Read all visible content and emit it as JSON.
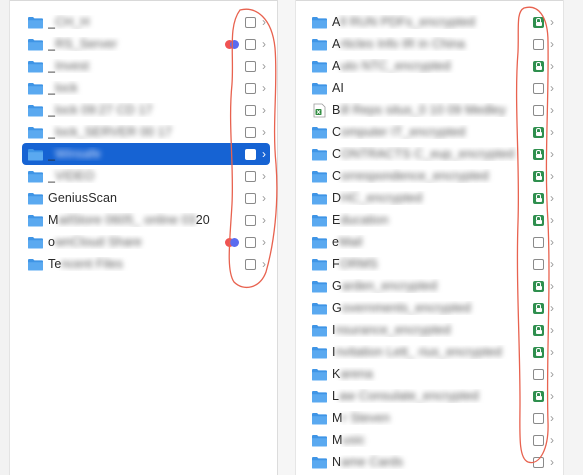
{
  "left_column": {
    "items": [
      {
        "lead": "_",
        "blurred": "CH_H",
        "tail": "",
        "status": "check",
        "tags": []
      },
      {
        "lead": "_",
        "blurred": "RS_Server",
        "tail": "",
        "status": "check",
        "tags": [
          "red",
          "blue"
        ]
      },
      {
        "lead": "_",
        "blurred": "Invest",
        "tail": "",
        "status": "check",
        "tags": []
      },
      {
        "lead": "_",
        "blurred": "lock",
        "tail": "",
        "status": "check",
        "tags": []
      },
      {
        "lead": "_",
        "blurred": "lock 09:27 CD 17",
        "tail": "",
        "status": "check",
        "tags": []
      },
      {
        "lead": "_",
        "blurred": "lock_SERVER 00 17",
        "tail": "",
        "status": "check",
        "tags": []
      },
      {
        "lead": "_",
        "blurred": "Winsafe",
        "tail": "",
        "status": "check",
        "tags": [],
        "selected": true
      },
      {
        "lead": "_",
        "blurred": "VIDEO",
        "tail": "",
        "status": "check",
        "tags": []
      },
      {
        "lead": "GeniusScan",
        "blurred": "",
        "tail": "",
        "status": "check",
        "tags": []
      },
      {
        "lead": "M",
        "blurred": "ailStore 0605_ online 03",
        "tail": "20",
        "status": "check",
        "tags": []
      },
      {
        "lead": "o",
        "blurred": "wnCloud Share",
        "tail": "",
        "status": "check",
        "tags": [
          "red",
          "blue"
        ]
      },
      {
        "lead": "Te",
        "blurred": "ncent Files",
        "tail": "",
        "status": "check",
        "tags": []
      }
    ]
  },
  "right_column": {
    "items": [
      {
        "lead": "A",
        "blurred": "ll RUN PDFs_encrypted",
        "tail": "",
        "status": "lock",
        "icon": "folder"
      },
      {
        "lead": "A",
        "blurred": "rticles Info IR in China",
        "tail": "",
        "status": "check",
        "icon": "folder"
      },
      {
        "lead": "A",
        "blurred": "uto NTC_encrypted",
        "tail": "",
        "status": "lock",
        "icon": "folder"
      },
      {
        "lead": "AI",
        "blurred": "",
        "tail": "",
        "status": "check",
        "icon": "folder"
      },
      {
        "lead": "B",
        "blurred": "ill Reps situs_0 10 09 Medley",
        "tail": "",
        "status": "check",
        "icon": "xls"
      },
      {
        "lead": "C",
        "blurred": "omputer IT_encrypted",
        "tail": "",
        "status": "lock",
        "icon": "folder"
      },
      {
        "lead": "C",
        "blurred": "ONTRACTS C_eup_encrypted",
        "tail": "",
        "status": "lock",
        "icon": "folder"
      },
      {
        "lead": "C",
        "blurred": "orrespondence_encrypted",
        "tail": "",
        "status": "lock",
        "icon": "folder"
      },
      {
        "lead": "D",
        "blurred": "HC_encrypted",
        "tail": "",
        "status": "lock",
        "icon": "folder"
      },
      {
        "lead": "E",
        "blurred": "ducation",
        "tail": "",
        "status": "lock",
        "icon": "folder"
      },
      {
        "lead": "e",
        "blurred": "Mail",
        "tail": "",
        "status": "check",
        "icon": "folder"
      },
      {
        "lead": "F",
        "blurred": "ORMS",
        "tail": "",
        "status": "check",
        "icon": "folder"
      },
      {
        "lead": "G",
        "blurred": "arden_encrypted",
        "tail": "",
        "status": "lock",
        "icon": "folder"
      },
      {
        "lead": "G",
        "blurred": "overnments_encrypted",
        "tail": "",
        "status": "lock",
        "icon": "folder"
      },
      {
        "lead": "I",
        "blurred": "nsurance_encrypted",
        "tail": "",
        "status": "lock",
        "icon": "folder"
      },
      {
        "lead": "I",
        "blurred": "nvitation Lett_ rius_encrypted",
        "tail": "",
        "status": "lock",
        "icon": "folder"
      },
      {
        "lead": "K",
        "blurred": "arena",
        "tail": "",
        "status": "check",
        "icon": "folder"
      },
      {
        "lead": "L",
        "blurred": "aw Consulate_encrypted",
        "tail": "",
        "status": "lock",
        "icon": "folder"
      },
      {
        "lead": "M",
        "blurred": "r Steven",
        "tail": "",
        "status": "check",
        "icon": "folder"
      },
      {
        "lead": "M",
        "blurred": "usic",
        "tail": "",
        "status": "check",
        "icon": "folder"
      },
      {
        "lead": "N",
        "blurred": "ame Cards",
        "tail": "",
        "status": "check",
        "icon": "folder"
      }
    ]
  },
  "colors": {
    "selection": "#1663d3",
    "folder_blue": "#3f95e6",
    "lock_green": "#2f8f4e",
    "tag_red": "#f05353",
    "tag_blue": "#5a6bf0",
    "annotation": "#e8624f"
  },
  "icons": {
    "folder": "folder-icon",
    "spreadsheet": "spreadsheet-icon",
    "lock": "lock-icon",
    "checkbox": "checkbox-icon",
    "chevron": "chevron-right-icon"
  },
  "chevron_glyph": "›"
}
